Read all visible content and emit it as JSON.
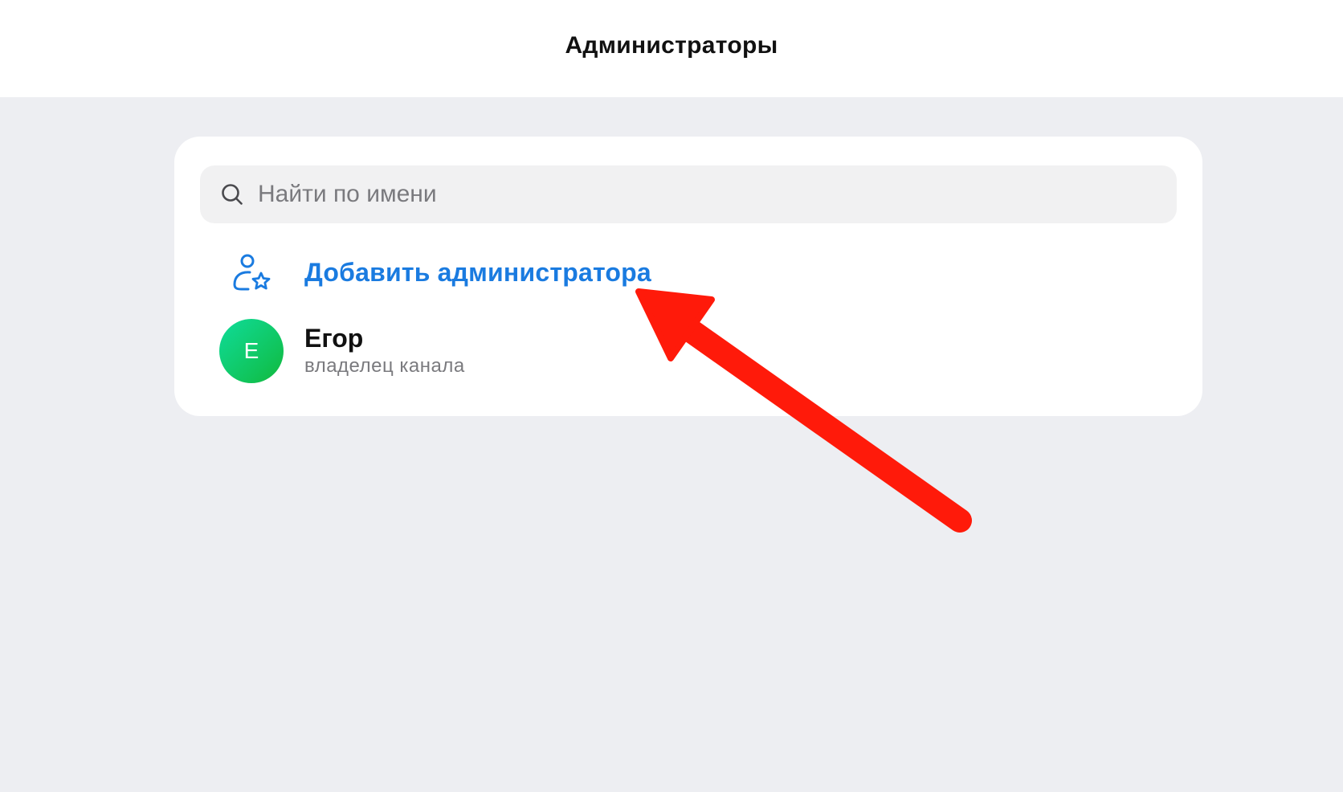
{
  "header": {
    "title": "Администраторы"
  },
  "search": {
    "placeholder": "Найти по имени",
    "value": "",
    "icon": "search-icon"
  },
  "add_admin": {
    "label": "Добавить администратора",
    "icon": "user-star-icon",
    "color": "#1a7be0"
  },
  "admins": [
    {
      "initial": "Е",
      "name": "Егор",
      "role": "владелец канала"
    }
  ],
  "annotation": {
    "type": "arrow",
    "color": "#ff1a0a",
    "points_to": "add-admin-button"
  }
}
